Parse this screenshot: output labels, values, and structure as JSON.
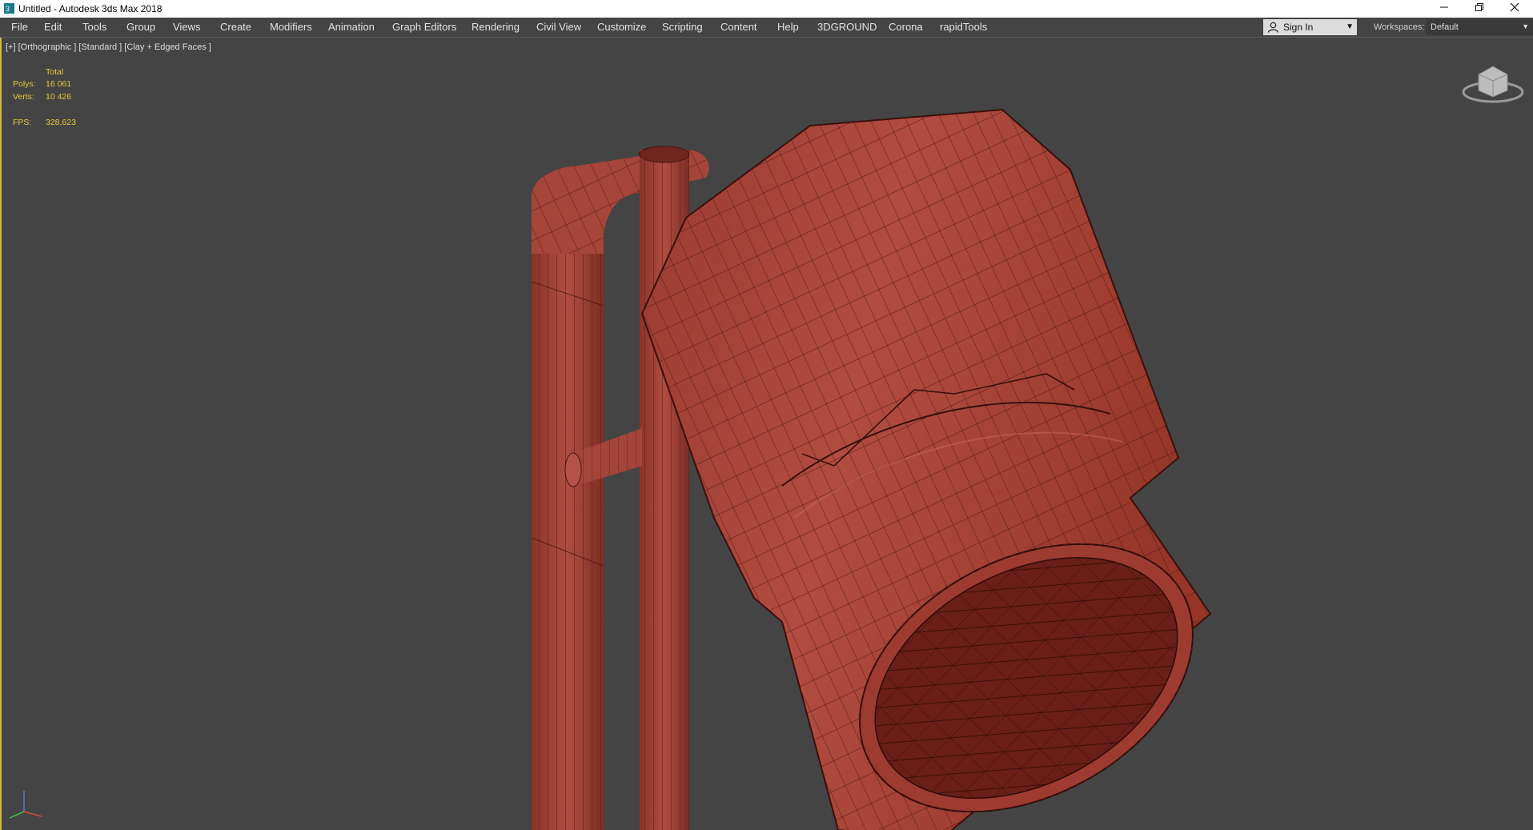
{
  "window": {
    "title": "Untitled - Autodesk 3ds Max 2018",
    "icon": "3ds-max-logo-icon",
    "controls": [
      "minimize-icon",
      "restore-icon",
      "close-icon"
    ]
  },
  "menubar": {
    "items": [
      "File",
      "Edit",
      "Tools",
      "Group",
      "Views",
      "Create",
      "Modifiers",
      "Animation",
      "Graph Editors",
      "Rendering",
      "Civil View",
      "Customize",
      "Scripting",
      "Content",
      "Help",
      "3DGROUND",
      "Corona",
      "rapidTools"
    ],
    "signin_label": "Sign In",
    "workspaces_label": "Workspaces:",
    "workspace_value": "Default"
  },
  "viewport": {
    "label": "[+] [Orthographic ] [Standard ] [Clay + Edged Faces ]",
    "stats": {
      "header": "Total",
      "polys_label": "Polys:",
      "polys_value": "16 061",
      "verts_label": "Verts:",
      "verts_value": "10 426",
      "fps_label": "FPS:",
      "fps_value": "328,623"
    }
  },
  "colors": {
    "viewport_bg": "#444444",
    "stats_text": "#e8c93a",
    "clay": "#a8453a",
    "wire": "#4a1611",
    "active_border": "#d4b74a"
  }
}
